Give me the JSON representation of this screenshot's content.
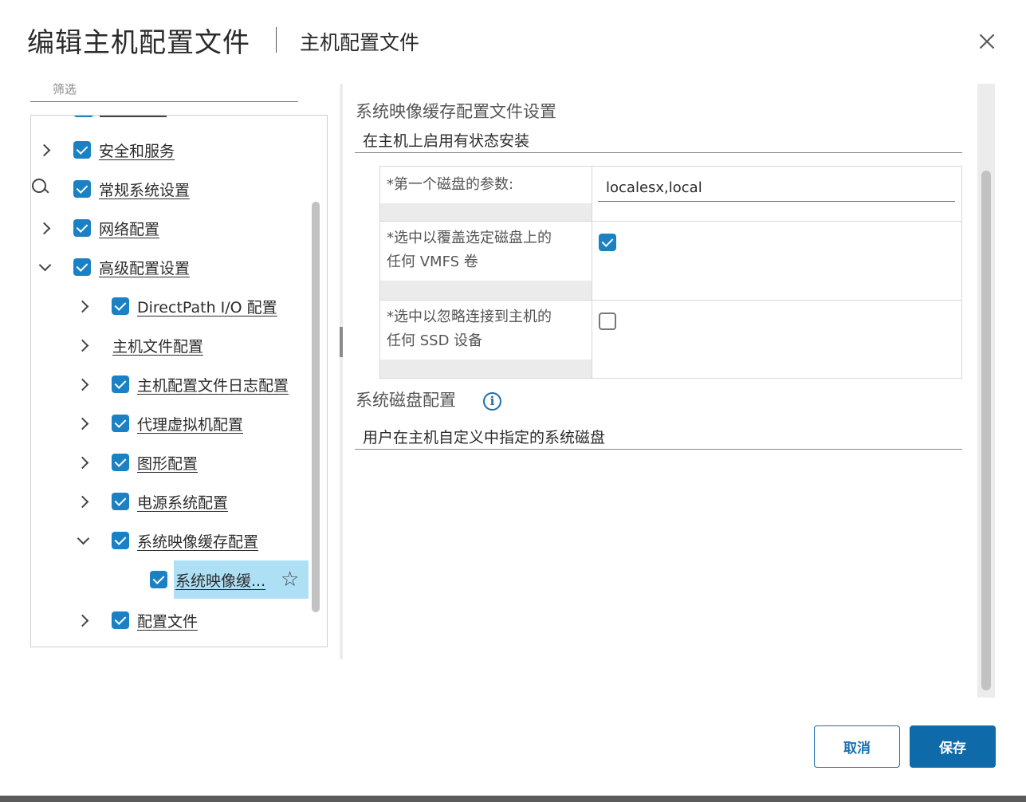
{
  "dialog": {
    "title": "编辑主机配置文件",
    "subtitle": "主机配置文件",
    "close_icon": "close-icon"
  },
  "filter": {
    "placeholder": "筛选"
  },
  "tree": {
    "items": [
      {
        "label": "安全和服务",
        "expanded": false,
        "checked": true
      },
      {
        "label": "常规系统设置",
        "expanded": false,
        "checked": true
      },
      {
        "label": "网络配置",
        "expanded": false,
        "checked": true
      },
      {
        "label": "高级配置设置",
        "expanded": true,
        "checked": true
      },
      {
        "label": "DirectPath I/O 配置",
        "expanded": false,
        "checked": true
      },
      {
        "label": "主机文件配置",
        "expanded": false,
        "checked": false
      },
      {
        "label": "主机配置文件日志配置",
        "expanded": false,
        "checked": true
      },
      {
        "label": "代理虚拟机配置",
        "expanded": false,
        "checked": true
      },
      {
        "label": "图形配置",
        "expanded": false,
        "checked": true
      },
      {
        "label": "电源系统配置",
        "expanded": false,
        "checked": true
      },
      {
        "label": "系统映像缓存配置",
        "expanded": true,
        "checked": true
      },
      {
        "label": "系统映像缓...",
        "selected": true,
        "checked": true
      },
      {
        "label": "配置文件",
        "expanded": false,
        "checked": true
      }
    ]
  },
  "main": {
    "section1_title": "系统映像缓存配置文件设置",
    "section1_value": "在主机上启用有状态安装",
    "params": [
      {
        "label": "*第一个磁盘的参数:",
        "value": "localesx,local"
      },
      {
        "label_line1": "*选中以覆盖选定磁盘上的",
        "label_line2": "任何 VMFS 卷",
        "checked": true
      },
      {
        "label_line1": "*选中以忽略连接到主机的",
        "label_line2": "任何 SSD 设备",
        "checked": false
      }
    ],
    "section2_title": "系统磁盘配置",
    "section2_value": "用户在主机自定义中指定的系统磁盘"
  },
  "footer": {
    "cancel_label": "取消",
    "save_label": "保存"
  },
  "colors": {
    "accent": "#1a82c4",
    "primary_button": "#0e6aa8",
    "selected_row": "#aee0f5"
  }
}
